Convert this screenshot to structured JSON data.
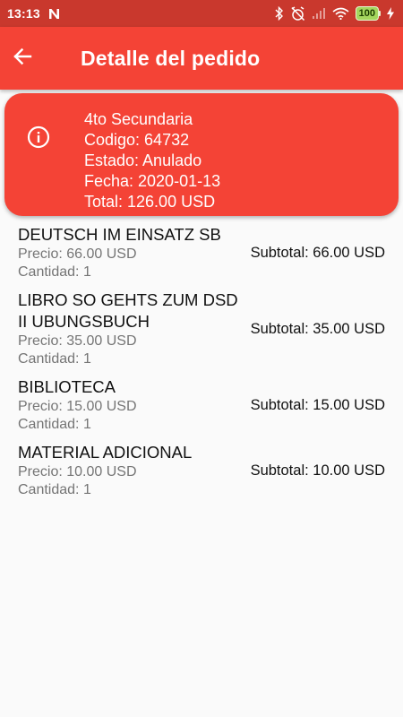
{
  "status_bar": {
    "time": "13:13",
    "battery": "100"
  },
  "app_bar": {
    "title": "Detalle del pedido",
    "back_icon": "arrow-back-icon"
  },
  "order": {
    "icon": "info-icon",
    "grade": "4to Secundaria",
    "code": "Codigo: 64732",
    "status": "Estado: Anulado",
    "date": "Fecha: 2020-01-13",
    "total": "Total: 126.00 USD"
  },
  "items": [
    {
      "name": "DEUTSCH IM EINSATZ SB",
      "price": "Precio: 66.00 USD",
      "quantity": "Cantidad: 1",
      "subtotal": "Subtotal: 66.00 USD"
    },
    {
      "name": "LIBRO SO GEHTS ZUM DSD II UBUNGSBUCH",
      "price": "Precio: 35.00 USD",
      "quantity": "Cantidad: 1",
      "subtotal": "Subtotal: 35.00 USD"
    },
    {
      "name": "BIBLIOTECA",
      "price": "Precio: 15.00 USD",
      "quantity": "Cantidad: 1",
      "subtotal": "Subtotal: 15.00 USD"
    },
    {
      "name": "MATERIAL ADICIONAL",
      "price": "Precio: 10.00 USD",
      "quantity": "Cantidad: 1",
      "subtotal": "Subtotal: 10.00 USD"
    }
  ],
  "colors": {
    "status_bar": "#c9382d",
    "primary": "#f44336",
    "background": "#fafafa",
    "secondary_text": "#757575"
  }
}
